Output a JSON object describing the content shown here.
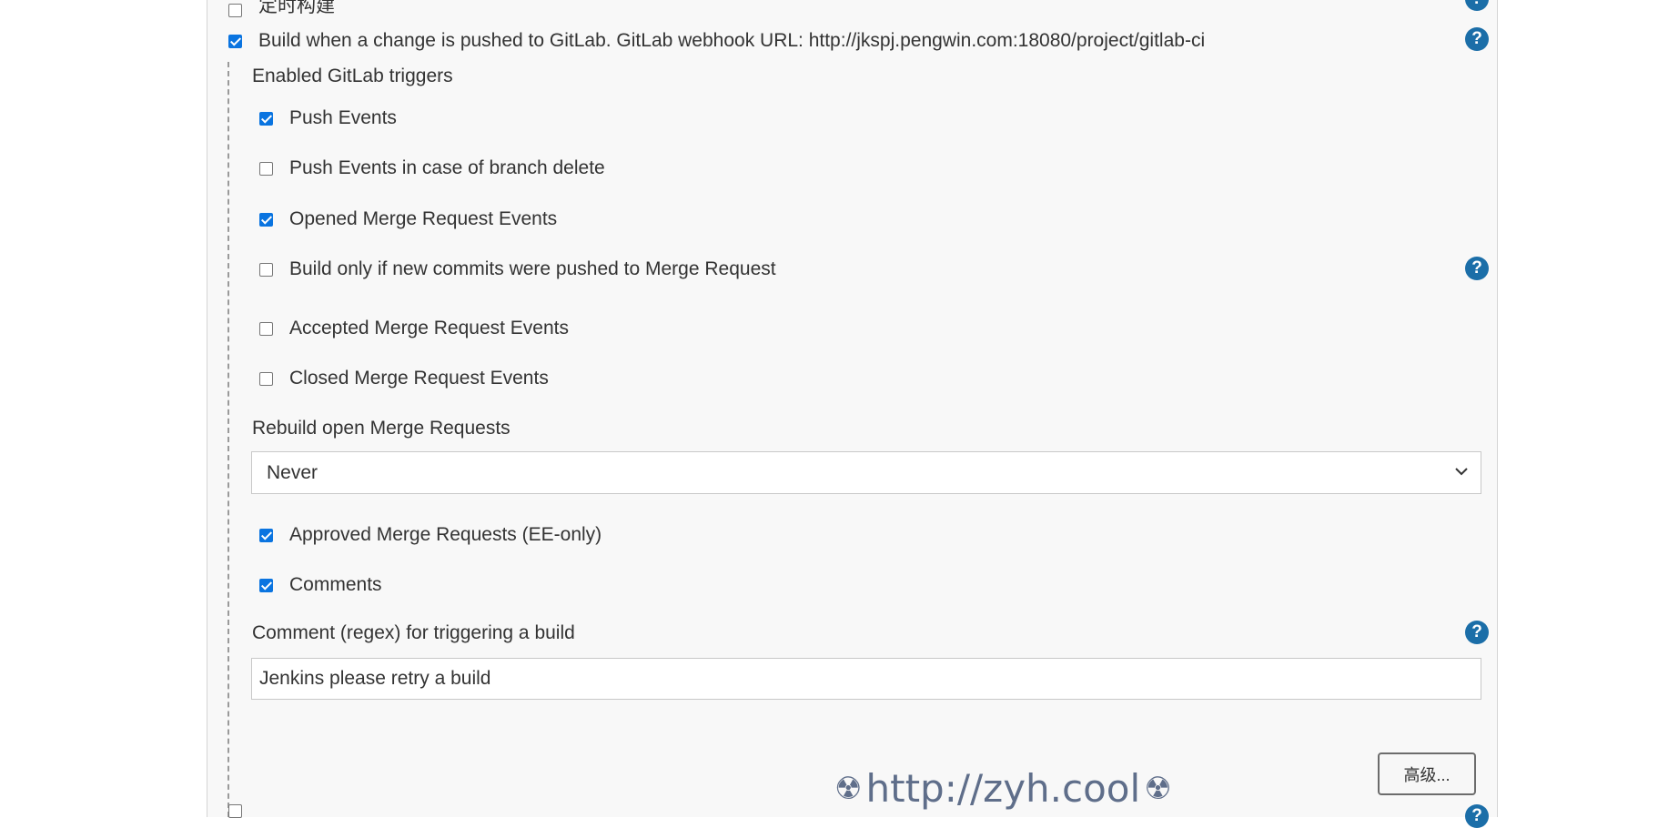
{
  "top_partial_option": {
    "label": "定时构建",
    "checked": false
  },
  "gitlab_trigger": {
    "label": "Build when a change is pushed to GitLab. GitLab webhook URL: http://jkspj.pengwin.com:18080/project/gitlab-ci",
    "checked": true
  },
  "enabled_triggers_heading": "Enabled GitLab triggers",
  "triggers": [
    {
      "label": "Push Events",
      "checked": true
    },
    {
      "label": "Push Events in case of branch delete",
      "checked": false
    },
    {
      "label": "Opened Merge Request Events",
      "checked": true
    },
    {
      "label": "Build only if new commits were pushed to Merge Request",
      "checked": false
    },
    {
      "label": "Accepted Merge Request Events",
      "checked": false
    },
    {
      "label": "Closed Merge Request Events",
      "checked": false
    }
  ],
  "rebuild": {
    "label": "Rebuild open Merge Requests",
    "selected": "Never"
  },
  "triggers2": [
    {
      "label": "Approved Merge Requests (EE-only)",
      "checked": true
    },
    {
      "label": "Comments",
      "checked": true
    }
  ],
  "comment_regex": {
    "label": "Comment (regex) for triggering a build",
    "value": "Jenkins please retry a build"
  },
  "advanced_button": "高级...",
  "watermark": {
    "text": "http://zyh.cool",
    "symbol": "☢"
  },
  "help_icon_glyph": "?",
  "colors": {
    "checkbox_checked": "#0a74e0",
    "help_icon": "#1b6ea8",
    "panel_bg": "#f8f8f8"
  }
}
